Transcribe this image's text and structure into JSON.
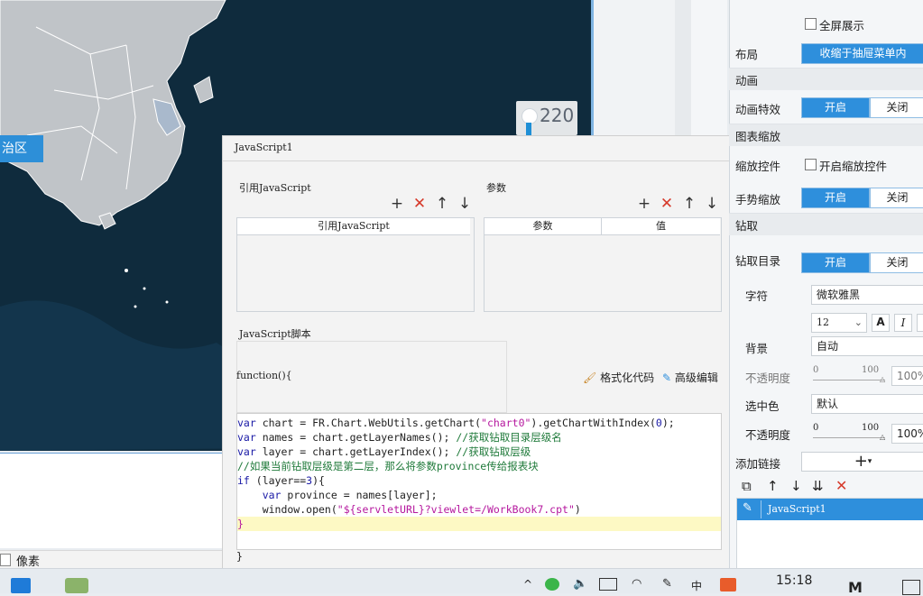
{
  "map": {
    "region_label": "治区",
    "legend_value": "220"
  },
  "bottom_left": {
    "unit_label": "像素"
  },
  "dialog": {
    "title": "JavaScript1",
    "ref_group_label": "引用JavaScript",
    "ref_table_header": "引用JavaScript",
    "param_group_label": "参数",
    "param_headers": [
      "参数",
      "值"
    ],
    "script_group_label": "JavaScript脚本",
    "function_header": "function(){",
    "format_code_label": "格式化代码",
    "advanced_edit_label": "高级编辑",
    "closing_brace": "}",
    "toolbar_icons": {
      "add": "+",
      "delete": "✕",
      "up": "↑",
      "down": "↓"
    },
    "code_lines": [
      {
        "segs": [
          [
            "kw",
            "var"
          ],
          [
            "",
            "chart = FR.Chart.WebUtils.getChart("
          ],
          [
            "str",
            "\"chart0\""
          ],
          [
            "",
            ").getChartWithIndex("
          ],
          [
            "num",
            "0"
          ],
          [
            "",
            ");"
          ]
        ]
      },
      {
        "segs": [
          [
            "kw",
            "var"
          ],
          [
            "",
            "names = chart.getLayerNames(); "
          ],
          [
            "cm",
            "//获取钻取目录层级名"
          ]
        ]
      },
      {
        "segs": [
          [
            "kw",
            "var"
          ],
          [
            "",
            "layer = chart.getLayerIndex(); "
          ],
          [
            "cm",
            "//获取钻取层级"
          ]
        ]
      },
      {
        "segs": [
          [
            "cm",
            "//如果当前钻取层级是第二层，那么将参数province传给报表块"
          ]
        ]
      },
      {
        "segs": [
          [
            "kw",
            "if"
          ],
          [
            "",
            " (layer=="
          ],
          [
            "num",
            "3"
          ],
          [
            "",
            "){"
          ]
        ]
      },
      {
        "segs": [
          [
            "",
            "    "
          ],
          [
            "kw",
            "var"
          ],
          [
            "",
            " province = names[layer];"
          ]
        ]
      },
      {
        "segs": [
          [
            "",
            "    window.open("
          ],
          [
            "str",
            "\"${servletURL}?viewlet=/WorkBook7.cpt\""
          ],
          [
            "",
            ")"
          ]
        ]
      },
      {
        "segs": [
          [
            "str",
            "}"
          ]
        ]
      }
    ]
  },
  "right_panel": {
    "fullscreen_label": "全屏展示",
    "layout_label": "布局",
    "layout_value": "收缩于抽屉菜单内",
    "animation_section": "动画",
    "anim_effect_label": "动画特效",
    "on": "开启",
    "off": "关闭",
    "zoom_section": "图表缩放",
    "zoom_control_label": "缩放控件",
    "zoom_control_check": "开启缩放控件",
    "gesture_zoom_label": "手势缩放",
    "drill_section": "钻取",
    "drill_dir_label": "钻取目录",
    "font_label": "字符",
    "font_value": "微软雅黑",
    "font_size": "12",
    "bold_icon": "A",
    "italic_icon": "I",
    "bg_label": "背景",
    "bg_value": "自动",
    "opacity_label": "不透明度",
    "slider_min": "0",
    "slider_max": "100",
    "opacity_value": "100%",
    "selected_color_label": "选中色",
    "selected_color_value": "默认",
    "opacity2_label": "不透明度",
    "opacity2_value": "100%",
    "add_link_label": "添加链接",
    "add_link_plus": "+",
    "link_item": "JavaScript1"
  },
  "taskbar": {
    "time": "15:18"
  },
  "colors": {
    "accent": "#2e8fdc",
    "map_bg": "#0f2b3d",
    "land": "#bfc3c7",
    "delete_red": "#d63a2b"
  }
}
